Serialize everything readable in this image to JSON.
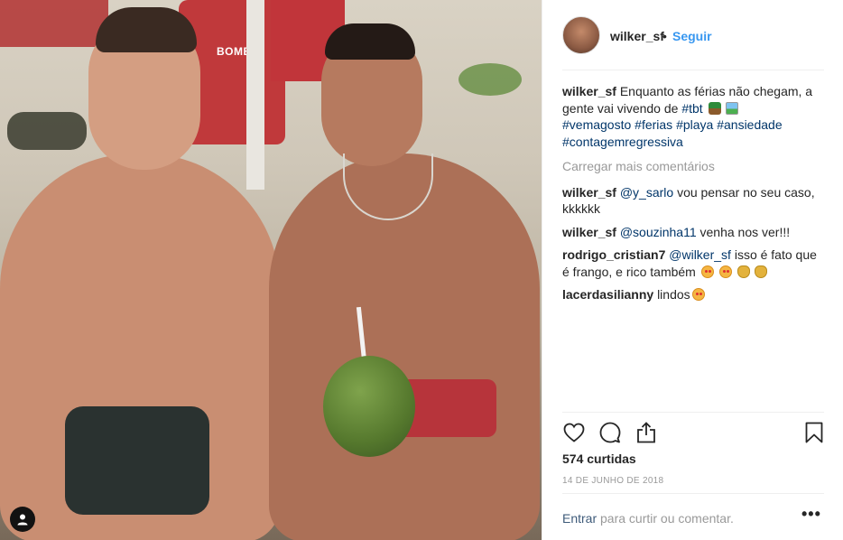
{
  "photo": {
    "bag_text": "BOMBE"
  },
  "post": {
    "author": "wilker_sf",
    "dot": "•",
    "follow_label": "Seguir",
    "caption": {
      "username": "wilker_sf",
      "text": "Enquanto as férias não chegam, a gente vai vivendo de",
      "tag_tbt": "#tbt",
      "hashtags_line1": "#vemagosto #ferias #playa #ansiedade",
      "hashtags_line2": "#contagemregressiva"
    },
    "load_more": "Carregar mais comentários",
    "comments": [
      {
        "user": "wilker_sf",
        "mention": "@y_sarlo",
        "text": "vou pensar no seu caso, kkkkkk"
      },
      {
        "user": "wilker_sf",
        "mention": "@souzinha11",
        "text": "venha nos ver!!!"
      },
      {
        "user": "rodrigo_cristian7",
        "mention": "@wilker_sf",
        "text": "isso é fato que é frango, e rico também"
      },
      {
        "user": "lacerdasilianny",
        "mention": "",
        "text": "lindos"
      }
    ],
    "likes": "574 curtidas",
    "date": "14 DE JUNHO DE 2018",
    "login_link": "Entrar",
    "login_suffix": "para curtir ou comentar.",
    "options_glyph": "•••"
  },
  "icons": {
    "like": "heart-icon",
    "comment": "comment-icon",
    "share": "share-icon",
    "save": "bookmark-icon",
    "user_tag": "user-icon"
  },
  "colors": {
    "link_blue": "#3897f0",
    "mention": "#003569",
    "muted": "#999999",
    "text": "#262626"
  }
}
